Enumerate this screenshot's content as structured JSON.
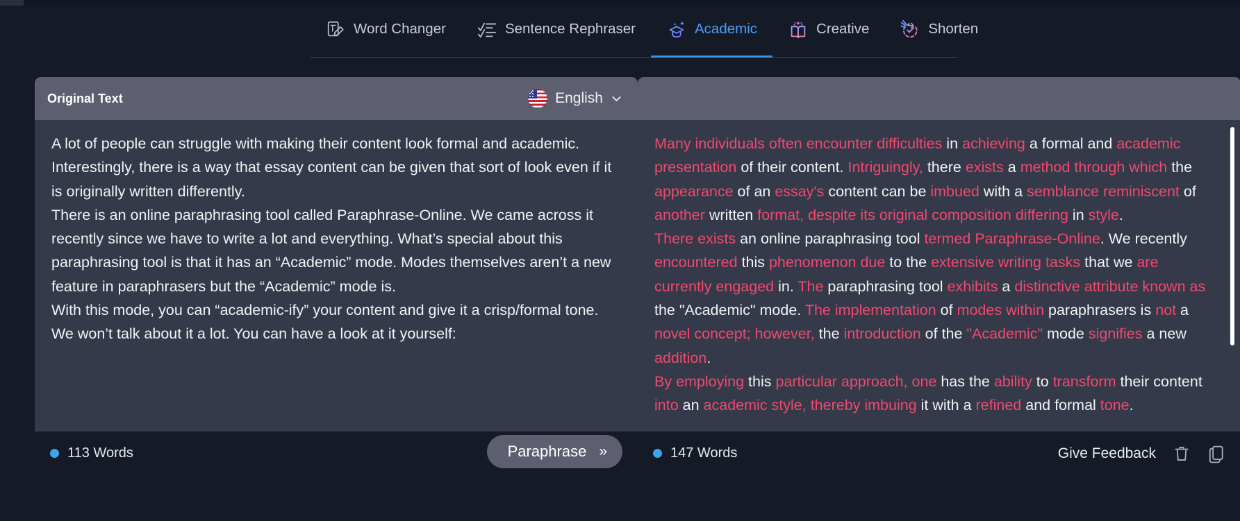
{
  "tabs": [
    {
      "id": "word-changer",
      "label": "Word Changer",
      "icon": "word-changer-icon",
      "active": false
    },
    {
      "id": "sentence-rephraser",
      "label": "Sentence Rephraser",
      "icon": "sentence-rephraser-icon",
      "active": false
    },
    {
      "id": "academic",
      "label": "Academic",
      "icon": "academic-cap-icon",
      "active": true
    },
    {
      "id": "creative",
      "label": "Creative",
      "icon": "creative-book-icon",
      "active": false
    },
    {
      "id": "shorten",
      "label": "Shorten",
      "icon": "shorten-icon",
      "active": false
    }
  ],
  "left_panel": {
    "title": "Original Text",
    "language": {
      "label": "English",
      "flag": "us-flag-icon",
      "chevron": "chevron-down-icon"
    },
    "text": "A lot of people can struggle with making their content look formal and academic. Interestingly, there is a way that essay content can be given that sort of look even if it is originally written differently.\nThere is an online paraphrasing tool called Paraphrase-Online. We came across it recently since we have to write a lot and everything. What’s special about this paraphrasing tool is that it has an “Academic” mode. Modes themselves aren’t a new feature in paraphrasers but the “Academic” mode is.\nWith this mode, you can “academic-ify” your content and give it a crisp/formal tone. We won’t talk about it a lot. You can have a look at it yourself:",
    "word_count": "113 Words",
    "paraphrase_button": "Paraphrase",
    "paraphrase_arrows": "»"
  },
  "right_panel": {
    "title": "",
    "word_count": "147 Words",
    "give_feedback": "Give Feedback",
    "delete_icon": "trash-icon",
    "copy_icon": "copy-icon",
    "paragraphs": [
      [
        {
          "t": "Many individuals often encounter difficulties",
          "h": true
        },
        {
          "t": " in ",
          "h": false
        },
        {
          "t": "achieving",
          "h": true
        },
        {
          "t": " a formal and ",
          "h": false
        },
        {
          "t": "academic presentation",
          "h": true
        },
        {
          "t": " of their content. ",
          "h": false
        },
        {
          "t": "Intriguingly,",
          "h": true
        },
        {
          "t": " there ",
          "h": false
        },
        {
          "t": "exists",
          "h": true
        },
        {
          "t": " a ",
          "h": false
        },
        {
          "t": "method through which",
          "h": true
        },
        {
          "t": " the ",
          "h": false
        },
        {
          "t": "appearance",
          "h": true
        },
        {
          "t": " of an ",
          "h": false
        },
        {
          "t": "essay's",
          "h": true
        },
        {
          "t": " content can be ",
          "h": false
        },
        {
          "t": "imbued",
          "h": true
        },
        {
          "t": " with a ",
          "h": false
        },
        {
          "t": "semblance reminiscent",
          "h": true
        },
        {
          "t": " of ",
          "h": false
        },
        {
          "t": "another",
          "h": true
        },
        {
          "t": " written ",
          "h": false
        },
        {
          "t": "format, despite its original composition differing",
          "h": true
        },
        {
          "t": " in ",
          "h": false
        },
        {
          "t": "style",
          "h": true
        },
        {
          "t": ".",
          "h": false
        }
      ],
      [
        {
          "t": "There exists",
          "h": true
        },
        {
          "t": " an online paraphrasing tool ",
          "h": false
        },
        {
          "t": "termed Paraphrase-Online",
          "h": true
        },
        {
          "t": ". We recently ",
          "h": false
        },
        {
          "t": "encountered",
          "h": true
        },
        {
          "t": " this ",
          "h": false
        },
        {
          "t": "phenomenon due",
          "h": true
        },
        {
          "t": " to the ",
          "h": false
        },
        {
          "t": "extensive writing tasks",
          "h": true
        },
        {
          "t": " that we ",
          "h": false
        },
        {
          "t": "are currently engaged",
          "h": true
        },
        {
          "t": " in. ",
          "h": false
        },
        {
          "t": "The",
          "h": true
        },
        {
          "t": " paraphrasing tool ",
          "h": false
        },
        {
          "t": "exhibits",
          "h": true
        },
        {
          "t": " a ",
          "h": false
        },
        {
          "t": "distinctive attribute known as",
          "h": true
        },
        {
          "t": " the \"Academic\" mode. ",
          "h": false
        },
        {
          "t": "The implementation",
          "h": true
        },
        {
          "t": " of ",
          "h": false
        },
        {
          "t": "modes within",
          "h": true
        },
        {
          "t": " paraphrasers is ",
          "h": false
        },
        {
          "t": "not",
          "h": true
        },
        {
          "t": " a ",
          "h": false
        },
        {
          "t": "novel concept; however,",
          "h": true
        },
        {
          "t": " the ",
          "h": false
        },
        {
          "t": "introduction",
          "h": true
        },
        {
          "t": " of the ",
          "h": false
        },
        {
          "t": "\"Academic\"",
          "h": true
        },
        {
          "t": " mode ",
          "h": false
        },
        {
          "t": "signifies",
          "h": true
        },
        {
          "t": " a new ",
          "h": false
        },
        {
          "t": "addition",
          "h": true
        },
        {
          "t": ".",
          "h": false
        }
      ],
      [
        {
          "t": "By employing",
          "h": true
        },
        {
          "t": " this ",
          "h": false
        },
        {
          "t": "particular approach, one",
          "h": true
        },
        {
          "t": " has the ",
          "h": false
        },
        {
          "t": "ability",
          "h": true
        },
        {
          "t": " to ",
          "h": false
        },
        {
          "t": "transform",
          "h": true
        },
        {
          "t": " their content ",
          "h": false
        },
        {
          "t": "into",
          "h": true
        },
        {
          "t": " an ",
          "h": false
        },
        {
          "t": "academic style, thereby imbuing",
          "h": true
        },
        {
          "t": " it with a ",
          "h": false
        },
        {
          "t": "refined",
          "h": true
        },
        {
          "t": " and formal ",
          "h": false
        },
        {
          "t": "tone",
          "h": true
        },
        {
          "t": ".",
          "h": false
        }
      ]
    ]
  },
  "colors": {
    "accent_blue": "#3f8fe8",
    "highlight_pink": "#f2486e",
    "panel_header": "#5d5f70",
    "panel_body": "#343a49",
    "page_bg": "#151a27"
  }
}
